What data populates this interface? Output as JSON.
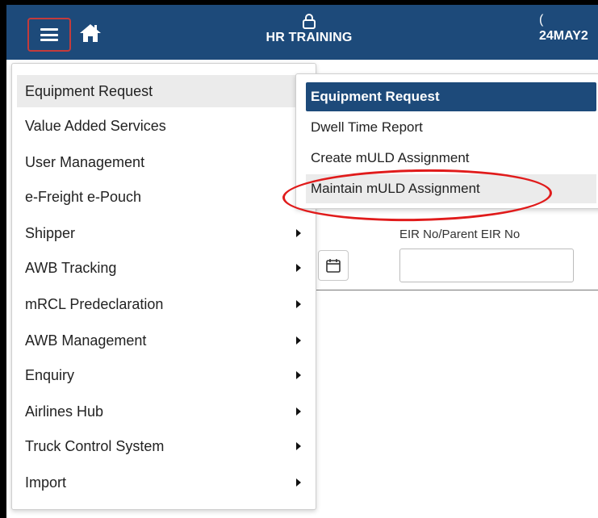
{
  "header": {
    "user_label": "HR TRAINING",
    "date_label": "24MAY2",
    "date_top_glyph": "(",
    "colors": {
      "bar": "#1d4a7a",
      "menu_button_border": "#c43b3b"
    }
  },
  "form": {
    "eir_label": "EIR No/Parent EIR No",
    "eir_value": ""
  },
  "main_menu": {
    "items": [
      {
        "label": "Equipment Request",
        "active": true
      },
      {
        "label": "Value Added Services"
      },
      {
        "label": "User Management"
      },
      {
        "label": "e-Freight e-Pouch"
      },
      {
        "label": "Shipper"
      },
      {
        "label": "AWB Tracking"
      },
      {
        "label": "mRCL Predeclaration"
      },
      {
        "label": "AWB Management"
      },
      {
        "label": "Enquiry"
      },
      {
        "label": "Airlines Hub"
      },
      {
        "label": "Truck Control System"
      },
      {
        "label": "Import"
      }
    ]
  },
  "sub_menu": {
    "items": [
      {
        "label": "Equipment Request",
        "state": "selected"
      },
      {
        "label": "Dwell Time Report"
      },
      {
        "label": "Create mULD Assignment"
      },
      {
        "label": "Maintain mULD Assignment",
        "state": "hover"
      }
    ]
  },
  "annotation": {
    "color": "#e01b1b",
    "target": "Maintain mULD Assignment"
  }
}
